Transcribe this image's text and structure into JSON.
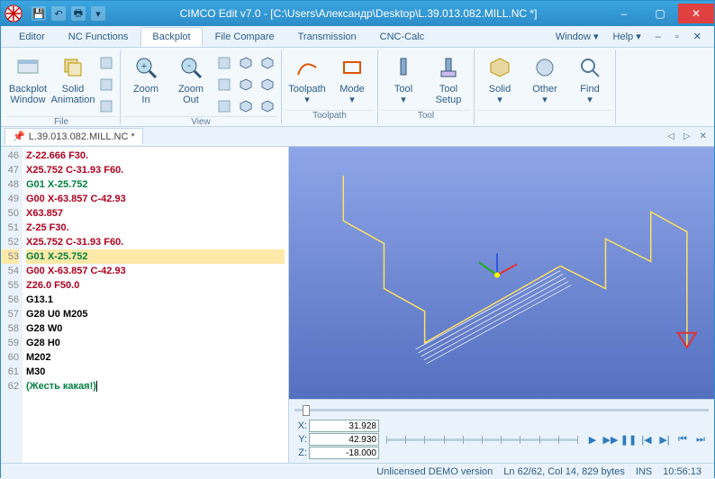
{
  "title": "CIMCO Edit v7.0 - [C:\\Users\\Александр\\Desktop\\L.39.013.082.MILL.NC *]",
  "menu": {
    "tabs": [
      "Editor",
      "NC Functions",
      "Backplot",
      "File Compare",
      "Transmission",
      "CNC-Calc"
    ],
    "active": 2,
    "right": [
      "Window ▾",
      "Help ▾"
    ]
  },
  "ribbon": {
    "groups": [
      {
        "label": "File",
        "buttons": [
          {
            "name": "backplot-window",
            "text": "Backplot\nWindow"
          },
          {
            "name": "solid-animation",
            "text": "Solid\nAnimation"
          }
        ]
      },
      {
        "label": "View",
        "buttons": [
          {
            "name": "zoom-in",
            "text": "Zoom\nIn"
          },
          {
            "name": "zoom-out",
            "text": "Zoom\nOut"
          }
        ]
      },
      {
        "label": "Toolpath",
        "buttons": [
          {
            "name": "toolpath",
            "text": "Toolpath\n▾"
          },
          {
            "name": "mode",
            "text": "Mode\n▾"
          }
        ]
      },
      {
        "label": "Tool",
        "buttons": [
          {
            "name": "tool",
            "text": "Tool\n▾"
          },
          {
            "name": "tool-setup",
            "text": "Tool\nSetup"
          }
        ]
      },
      {
        "label": "",
        "buttons": [
          {
            "name": "solid",
            "text": "Solid\n▾"
          },
          {
            "name": "other",
            "text": "Other\n▾"
          },
          {
            "name": "find",
            "text": "Find\n▾"
          }
        ]
      }
    ]
  },
  "filetab": "L.39.013.082.MILL.NC *",
  "code": {
    "start": 46,
    "highlight": 53,
    "lines": [
      {
        "n": 46,
        "cls": "red",
        "t": "Z-22.666 F30."
      },
      {
        "n": 47,
        "cls": "red",
        "t": "X25.752 C-31.93 F60."
      },
      {
        "n": 48,
        "cls": "green",
        "t": "G01 X-25.752"
      },
      {
        "n": 49,
        "cls": "red",
        "t": "G00 X-63.857 C-42.93"
      },
      {
        "n": 50,
        "cls": "red",
        "t": "X63.857"
      },
      {
        "n": 51,
        "cls": "red",
        "t": "Z-25 F30."
      },
      {
        "n": 52,
        "cls": "red",
        "t": "X25.752 C-31.93 F60."
      },
      {
        "n": 53,
        "cls": "green",
        "t": "G01 X-25.752"
      },
      {
        "n": 54,
        "cls": "red",
        "t": "G00 X-63.857 C-42.93"
      },
      {
        "n": 55,
        "cls": "red",
        "t": "Z26.0 F50.0"
      },
      {
        "n": 56,
        "cls": "black",
        "t": "G13.1"
      },
      {
        "n": 57,
        "cls": "black",
        "t": "G28 U0 M205"
      },
      {
        "n": 58,
        "cls": "black",
        "t": "G28 W0"
      },
      {
        "n": 59,
        "cls": "black",
        "t": "G28 H0"
      },
      {
        "n": 60,
        "cls": "black",
        "t": "M202"
      },
      {
        "n": 61,
        "cls": "black",
        "t": "M30"
      },
      {
        "n": 62,
        "cls": "green",
        "t": "(Жесть какая!)"
      }
    ]
  },
  "coords": {
    "x": "31.928",
    "y": "42.930",
    "z": "-18.000"
  },
  "status": {
    "version": "Unlicensed DEMO version",
    "pos": "Ln 62/62, Col 14, 829 bytes",
    "ins": "INS",
    "time": "10:56:13"
  }
}
